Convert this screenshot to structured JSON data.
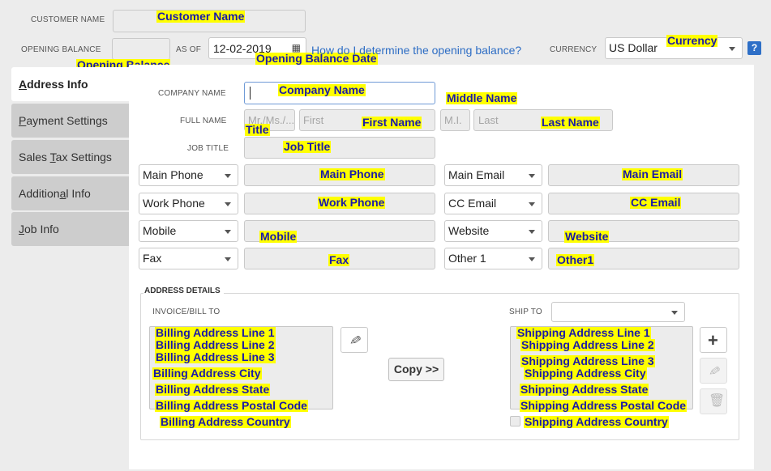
{
  "header": {
    "customer_name_label": "CUSTOMER NAME",
    "customer_name_annotation": "Customer Name",
    "opening_balance_label": "OPENING BALANCE",
    "opening_balance_annotation": "Opening Balance",
    "as_of_label": "AS OF",
    "date_value": "12-02-2019",
    "date_annotation": "Opening Balance Date",
    "help_link": "How do I determine the opening balance?",
    "currency_label": "CURRENCY",
    "currency_value": "US Dollar",
    "currency_annotation": "Currency",
    "help_button": "?"
  },
  "tabs": [
    {
      "pre": "",
      "u": "A",
      "post": "ddress Info"
    },
    {
      "pre": "",
      "u": "P",
      "post": "ayment Settings"
    },
    {
      "pre": "Sales ",
      "u": "T",
      "post": "ax Settings"
    },
    {
      "pre": "Addition",
      "u": "a",
      "post": "l Info"
    },
    {
      "pre": "",
      "u": "J",
      "post": "ob Info"
    }
  ],
  "form": {
    "company_label": "COMPANY NAME",
    "company_annotation": "Company Name",
    "full_name_label": "FULL NAME",
    "title_placeholder": "Mr./Ms./...",
    "title_annotation": "Title",
    "first_placeholder": "First",
    "first_annotation": "First Name",
    "middle_placeholder": "M.I.",
    "middle_annotation": "Middle Name",
    "last_placeholder": "Last",
    "last_annotation": "Last Name",
    "job_title_label": "JOB TITLE",
    "job_title_annotation": "Job Title"
  },
  "contacts_left": [
    {
      "type": "Main Phone",
      "annotation": "Main Phone"
    },
    {
      "type": "Work Phone",
      "annotation": "Work Phone"
    },
    {
      "type": "Mobile",
      "annotation": "Mobile"
    },
    {
      "type": "Fax",
      "annotation": "Fax"
    }
  ],
  "contacts_right": [
    {
      "type": "Main Email",
      "annotation": "Main Email"
    },
    {
      "type": "CC Email",
      "annotation": "CC Email"
    },
    {
      "type": "Website",
      "annotation": "Website"
    },
    {
      "type": "Other 1",
      "annotation": "Other1"
    }
  ],
  "address": {
    "section_title": "ADDRESS DETAILS",
    "invoice_label": "INVOICE/BILL TO",
    "ship_to_label": "SHIP TO",
    "copy_button": "Copy >>",
    "billing_lines": [
      "Billing Address Line 1",
      "Billing Address Line 2",
      "Billing Address Line 3",
      "Billing Address City",
      "Billing Address State",
      "Billing Address Postal Code",
      "Billing Address Country"
    ],
    "shipping_lines": [
      "Shipping Address Line 1",
      "Shipping Address Line 2",
      "Shipping Address Line 3",
      "Shipping Address City",
      "Shipping Address State",
      "Shipping Address Postal Code",
      "Shipping Address Country"
    ]
  }
}
